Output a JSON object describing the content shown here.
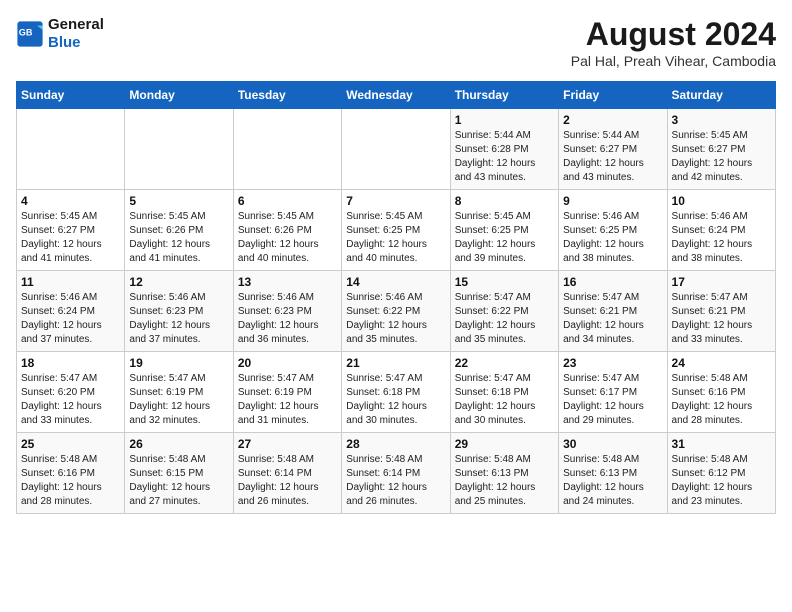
{
  "header": {
    "logo_line1": "General",
    "logo_line2": "Blue",
    "month_title": "August 2024",
    "location": "Pal Hal, Preah Vihear, Cambodia"
  },
  "days_of_week": [
    "Sunday",
    "Monday",
    "Tuesday",
    "Wednesday",
    "Thursday",
    "Friday",
    "Saturday"
  ],
  "weeks": [
    [
      {
        "day": "",
        "info": ""
      },
      {
        "day": "",
        "info": ""
      },
      {
        "day": "",
        "info": ""
      },
      {
        "day": "",
        "info": ""
      },
      {
        "day": "1",
        "info": "Sunrise: 5:44 AM\nSunset: 6:28 PM\nDaylight: 12 hours\nand 43 minutes."
      },
      {
        "day": "2",
        "info": "Sunrise: 5:44 AM\nSunset: 6:27 PM\nDaylight: 12 hours\nand 43 minutes."
      },
      {
        "day": "3",
        "info": "Sunrise: 5:45 AM\nSunset: 6:27 PM\nDaylight: 12 hours\nand 42 minutes."
      }
    ],
    [
      {
        "day": "4",
        "info": "Sunrise: 5:45 AM\nSunset: 6:27 PM\nDaylight: 12 hours\nand 41 minutes."
      },
      {
        "day": "5",
        "info": "Sunrise: 5:45 AM\nSunset: 6:26 PM\nDaylight: 12 hours\nand 41 minutes."
      },
      {
        "day": "6",
        "info": "Sunrise: 5:45 AM\nSunset: 6:26 PM\nDaylight: 12 hours\nand 40 minutes."
      },
      {
        "day": "7",
        "info": "Sunrise: 5:45 AM\nSunset: 6:25 PM\nDaylight: 12 hours\nand 40 minutes."
      },
      {
        "day": "8",
        "info": "Sunrise: 5:45 AM\nSunset: 6:25 PM\nDaylight: 12 hours\nand 39 minutes."
      },
      {
        "day": "9",
        "info": "Sunrise: 5:46 AM\nSunset: 6:25 PM\nDaylight: 12 hours\nand 38 minutes."
      },
      {
        "day": "10",
        "info": "Sunrise: 5:46 AM\nSunset: 6:24 PM\nDaylight: 12 hours\nand 38 minutes."
      }
    ],
    [
      {
        "day": "11",
        "info": "Sunrise: 5:46 AM\nSunset: 6:24 PM\nDaylight: 12 hours\nand 37 minutes."
      },
      {
        "day": "12",
        "info": "Sunrise: 5:46 AM\nSunset: 6:23 PM\nDaylight: 12 hours\nand 37 minutes."
      },
      {
        "day": "13",
        "info": "Sunrise: 5:46 AM\nSunset: 6:23 PM\nDaylight: 12 hours\nand 36 minutes."
      },
      {
        "day": "14",
        "info": "Sunrise: 5:46 AM\nSunset: 6:22 PM\nDaylight: 12 hours\nand 35 minutes."
      },
      {
        "day": "15",
        "info": "Sunrise: 5:47 AM\nSunset: 6:22 PM\nDaylight: 12 hours\nand 35 minutes."
      },
      {
        "day": "16",
        "info": "Sunrise: 5:47 AM\nSunset: 6:21 PM\nDaylight: 12 hours\nand 34 minutes."
      },
      {
        "day": "17",
        "info": "Sunrise: 5:47 AM\nSunset: 6:21 PM\nDaylight: 12 hours\nand 33 minutes."
      }
    ],
    [
      {
        "day": "18",
        "info": "Sunrise: 5:47 AM\nSunset: 6:20 PM\nDaylight: 12 hours\nand 33 minutes."
      },
      {
        "day": "19",
        "info": "Sunrise: 5:47 AM\nSunset: 6:19 PM\nDaylight: 12 hours\nand 32 minutes."
      },
      {
        "day": "20",
        "info": "Sunrise: 5:47 AM\nSunset: 6:19 PM\nDaylight: 12 hours\nand 31 minutes."
      },
      {
        "day": "21",
        "info": "Sunrise: 5:47 AM\nSunset: 6:18 PM\nDaylight: 12 hours\nand 30 minutes."
      },
      {
        "day": "22",
        "info": "Sunrise: 5:47 AM\nSunset: 6:18 PM\nDaylight: 12 hours\nand 30 minutes."
      },
      {
        "day": "23",
        "info": "Sunrise: 5:47 AM\nSunset: 6:17 PM\nDaylight: 12 hours\nand 29 minutes."
      },
      {
        "day": "24",
        "info": "Sunrise: 5:48 AM\nSunset: 6:16 PM\nDaylight: 12 hours\nand 28 minutes."
      }
    ],
    [
      {
        "day": "25",
        "info": "Sunrise: 5:48 AM\nSunset: 6:16 PM\nDaylight: 12 hours\nand 28 minutes."
      },
      {
        "day": "26",
        "info": "Sunrise: 5:48 AM\nSunset: 6:15 PM\nDaylight: 12 hours\nand 27 minutes."
      },
      {
        "day": "27",
        "info": "Sunrise: 5:48 AM\nSunset: 6:14 PM\nDaylight: 12 hours\nand 26 minutes."
      },
      {
        "day": "28",
        "info": "Sunrise: 5:48 AM\nSunset: 6:14 PM\nDaylight: 12 hours\nand 26 minutes."
      },
      {
        "day": "29",
        "info": "Sunrise: 5:48 AM\nSunset: 6:13 PM\nDaylight: 12 hours\nand 25 minutes."
      },
      {
        "day": "30",
        "info": "Sunrise: 5:48 AM\nSunset: 6:13 PM\nDaylight: 12 hours\nand 24 minutes."
      },
      {
        "day": "31",
        "info": "Sunrise: 5:48 AM\nSunset: 6:12 PM\nDaylight: 12 hours\nand 23 minutes."
      }
    ]
  ]
}
